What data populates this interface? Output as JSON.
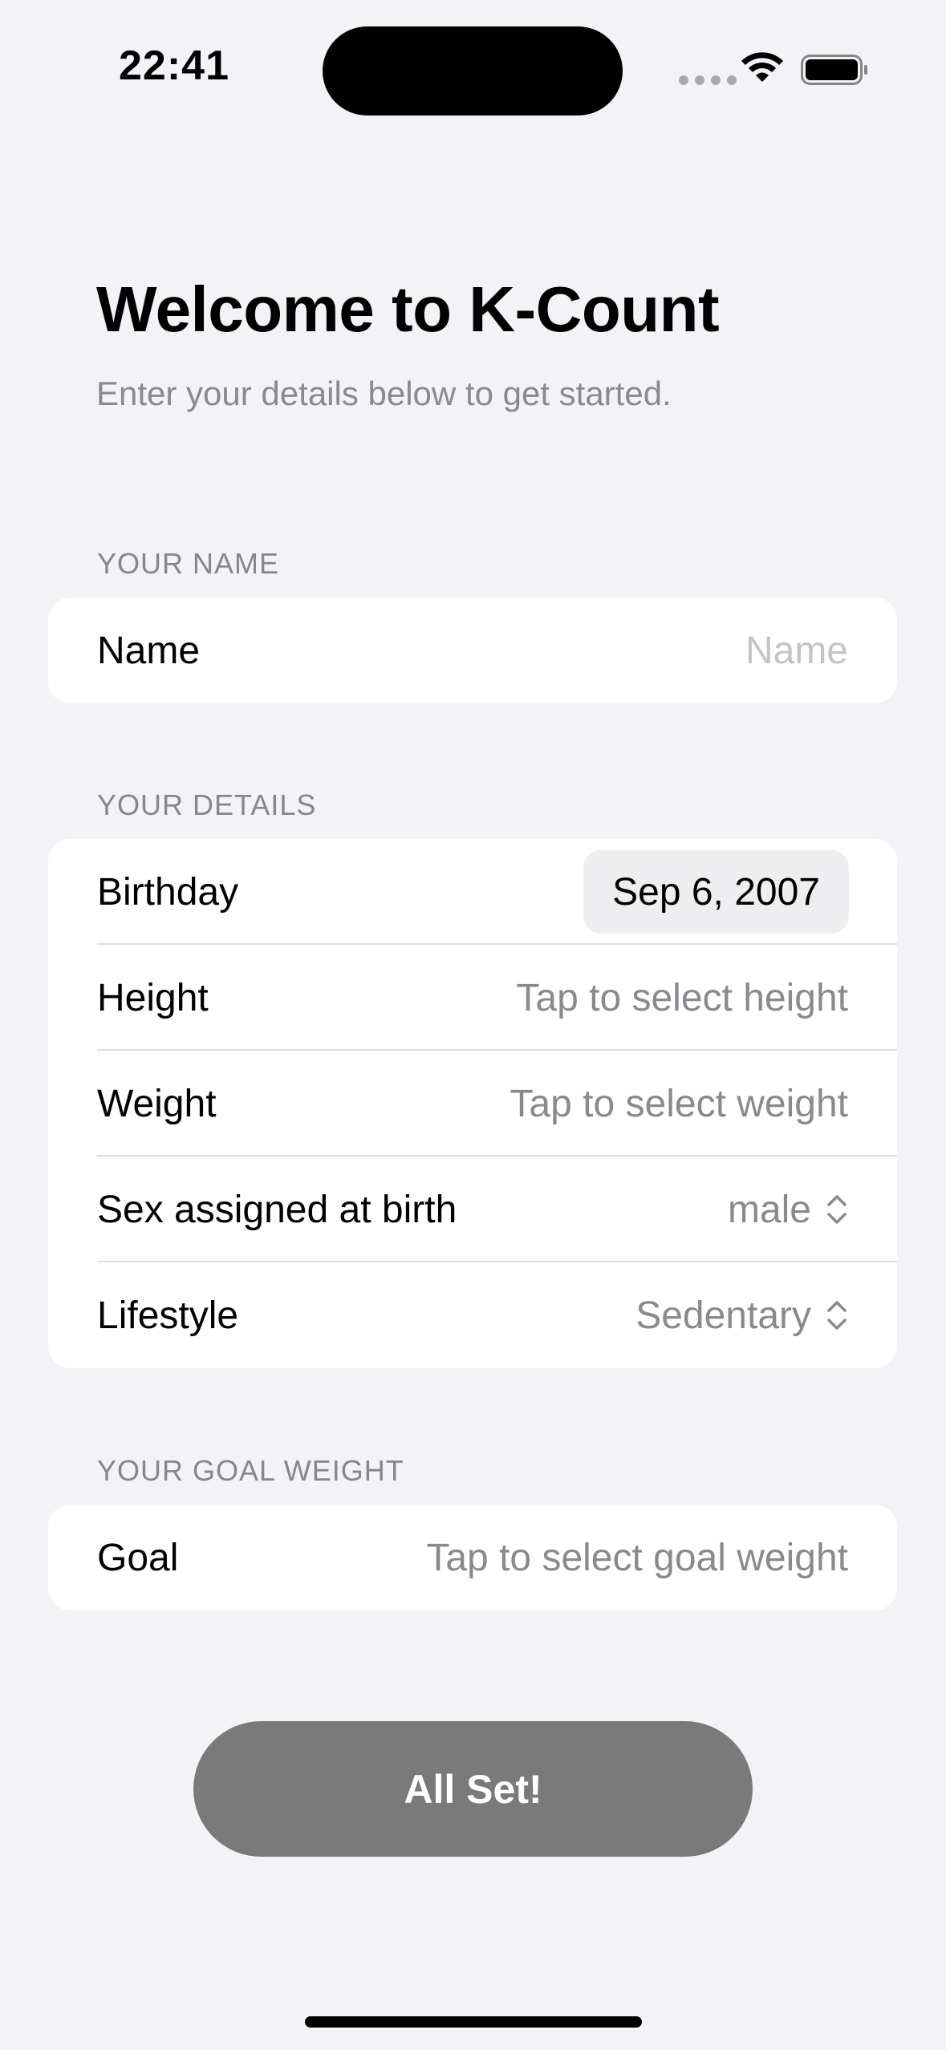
{
  "status_bar": {
    "time": "22:41"
  },
  "header": {
    "title": "Welcome to K-Count",
    "subtitle": "Enter your details below to get started."
  },
  "sections": {
    "name": {
      "label": "YOUR NAME",
      "row": {
        "label": "Name",
        "placeholder": "Name"
      }
    },
    "details": {
      "label": "YOUR DETAILS",
      "birthday": {
        "label": "Birthday",
        "value": "Sep 6, 2007"
      },
      "height": {
        "label": "Height",
        "value": "Tap to select height"
      },
      "weight": {
        "label": "Weight",
        "value": "Tap to select weight"
      },
      "sex": {
        "label": "Sex assigned at birth",
        "value": "male"
      },
      "lifestyle": {
        "label": "Lifestyle",
        "value": "Sedentary"
      }
    },
    "goal": {
      "label": "YOUR GOAL WEIGHT",
      "row": {
        "label": "Goal",
        "value": "Tap to select goal weight"
      }
    }
  },
  "cta": {
    "label": "All Set!"
  },
  "icons": {
    "wifi": "wifi-icon",
    "battery": "battery-icon",
    "chevron": "chevron-up-down-icon"
  }
}
